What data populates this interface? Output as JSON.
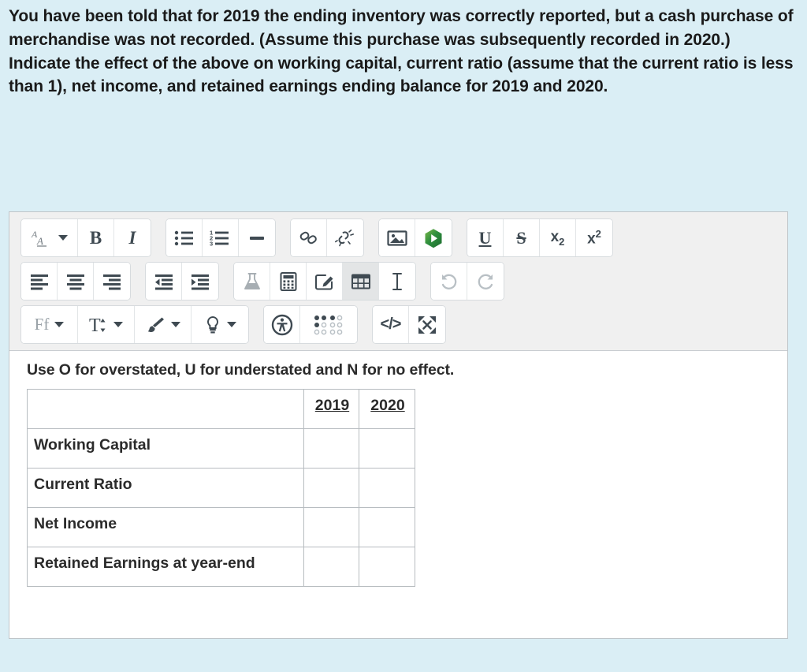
{
  "prompt": {
    "lines": [
      "You have been told that for 2019 the ending inventory was correctly reported, but a cash purchase of merchandise was not recorded. (Assume this purchase was subsequently recorded in 2020.)",
      "Indicate the effect of the above on working capital, current ratio (assume that the current ratio is less than 1), net income, and retained earnings ending balance for 2019 and 2020."
    ]
  },
  "colors": {
    "page_background": "#daeef5",
    "toolbar_background": "#f0f0f0",
    "button_background": "#ffffff",
    "icon": "#3f4a52",
    "icon_disabled": "#b9c0c5",
    "media_icon_green": "#2f8f3e",
    "text": "#2b2b2b",
    "border": "#bfc5c9"
  },
  "editor": {
    "toolbar": {
      "rows": [
        {
          "groups": [
            {
              "buttons": [
                {
                  "name": "paragraph-format-dropdown",
                  "icon": "paragraph-format-icon",
                  "label": "A",
                  "has_caret": true,
                  "state": "enabled"
                },
                {
                  "name": "bold-button",
                  "icon": "bold-icon",
                  "label": "B",
                  "state": "enabled"
                },
                {
                  "name": "italic-button",
                  "icon": "italic-icon",
                  "label": "I",
                  "state": "enabled"
                }
              ]
            },
            {
              "buttons": [
                {
                  "name": "bullet-list-button",
                  "icon": "bullet-list-icon",
                  "label": "",
                  "state": "enabled"
                },
                {
                  "name": "numbered-list-button",
                  "icon": "numbered-list-icon",
                  "label": "",
                  "state": "enabled"
                },
                {
                  "name": "horizontal-rule-button",
                  "icon": "horizontal-rule-icon",
                  "label": "",
                  "state": "enabled"
                }
              ]
            },
            {
              "buttons": [
                {
                  "name": "insert-link-button",
                  "icon": "link-icon",
                  "label": "",
                  "state": "enabled"
                },
                {
                  "name": "remove-link-button",
                  "icon": "unlink-icon",
                  "label": "",
                  "state": "enabled"
                }
              ]
            },
            {
              "buttons": [
                {
                  "name": "insert-image-button",
                  "icon": "image-icon",
                  "label": "",
                  "state": "enabled"
                },
                {
                  "name": "insert-media-button",
                  "icon": "media-play-icon",
                  "label": "",
                  "state": "enabled"
                }
              ]
            },
            {
              "buttons": [
                {
                  "name": "underline-button",
                  "icon": "underline-icon",
                  "label": "U",
                  "state": "enabled"
                },
                {
                  "name": "strikethrough-button",
                  "icon": "strikethrough-icon",
                  "label": "S",
                  "state": "enabled"
                },
                {
                  "name": "subscript-button",
                  "icon": "subscript-icon",
                  "label": "x2",
                  "state": "enabled"
                },
                {
                  "name": "superscript-button",
                  "icon": "superscript-icon",
                  "label": "x2",
                  "state": "enabled"
                }
              ]
            }
          ]
        },
        {
          "groups": [
            {
              "buttons": [
                {
                  "name": "align-left-button",
                  "icon": "align-left-icon",
                  "label": "",
                  "state": "enabled"
                },
                {
                  "name": "align-center-button",
                  "icon": "align-center-icon",
                  "label": "",
                  "state": "enabled"
                },
                {
                  "name": "align-right-button",
                  "icon": "align-right-icon",
                  "label": "",
                  "state": "enabled"
                }
              ]
            },
            {
              "buttons": [
                {
                  "name": "outdent-button",
                  "icon": "outdent-icon",
                  "label": "",
                  "state": "enabled"
                },
                {
                  "name": "indent-button",
                  "icon": "indent-icon",
                  "label": "",
                  "state": "enabled"
                }
              ]
            },
            {
              "buttons": [
                {
                  "name": "chemistry-equation-button",
                  "icon": "flask-icon",
                  "label": "",
                  "state": "disabled"
                },
                {
                  "name": "math-equation-button",
                  "icon": "calculator-icon",
                  "label": "",
                  "state": "enabled"
                },
                {
                  "name": "draw-button",
                  "icon": "pencil-square-icon",
                  "label": "",
                  "state": "enabled"
                },
                {
                  "name": "insert-table-button",
                  "icon": "table-icon",
                  "label": "",
                  "state": "active"
                },
                {
                  "name": "text-cursor-button",
                  "icon": "text-cursor-icon",
                  "label": "",
                  "state": "enabled"
                }
              ]
            },
            {
              "buttons": [
                {
                  "name": "undo-button",
                  "icon": "undo-icon",
                  "label": "",
                  "state": "disabled"
                },
                {
                  "name": "redo-button",
                  "icon": "redo-icon",
                  "label": "",
                  "state": "disabled"
                }
              ]
            }
          ]
        },
        {
          "groups": [
            {
              "buttons": [
                {
                  "name": "font-family-dropdown",
                  "icon": "font-family-icon",
                  "label": "Ff",
                  "has_caret": true,
                  "state": "enabled"
                },
                {
                  "name": "font-size-dropdown",
                  "icon": "font-size-icon",
                  "label": "T",
                  "has_caret": true,
                  "state": "enabled"
                },
                {
                  "name": "text-color-dropdown",
                  "icon": "paintbrush-icon",
                  "label": "",
                  "has_caret": true,
                  "state": "enabled"
                },
                {
                  "name": "highlight-color-dropdown",
                  "icon": "lightbulb-icon",
                  "label": "",
                  "has_caret": true,
                  "state": "enabled"
                }
              ]
            },
            {
              "buttons": [
                {
                  "name": "accessibility-checker-button",
                  "icon": "accessibility-icon",
                  "label": "",
                  "state": "enabled"
                },
                {
                  "name": "braille-button",
                  "icon": "braille-dots-icon",
                  "label": "",
                  "state": "enabled"
                }
              ]
            },
            {
              "buttons": [
                {
                  "name": "html-source-button",
                  "icon": "code-brackets-icon",
                  "label": "</>",
                  "state": "enabled"
                },
                {
                  "name": "fullscreen-button",
                  "icon": "expand-arrows-icon",
                  "label": "",
                  "state": "enabled"
                }
              ]
            }
          ]
        }
      ]
    },
    "content": {
      "instruction": "Use O for overstated, U for understated and N for no effect.",
      "table": {
        "headers": [
          "",
          "2019",
          "2020"
        ],
        "rows": [
          {
            "label": "Working Capital",
            "v2019": "",
            "v2020": ""
          },
          {
            "label": "Current Ratio",
            "v2019": "",
            "v2020": ""
          },
          {
            "label": "Net Income",
            "v2019": "",
            "v2020": ""
          },
          {
            "label": "Retained Earnings at year-end",
            "v2019": "",
            "v2020": ""
          }
        ]
      }
    }
  }
}
